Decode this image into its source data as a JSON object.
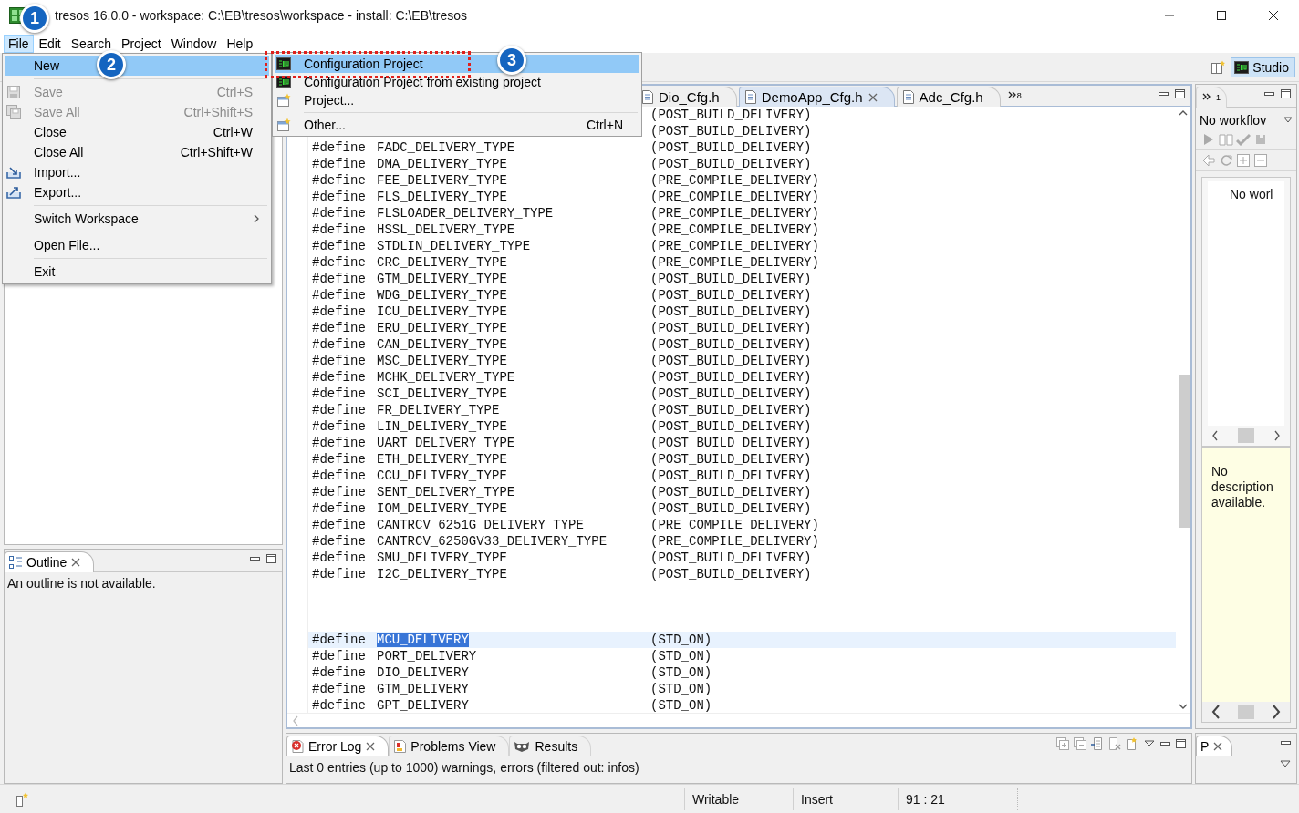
{
  "window": {
    "title": "tresos 16.0.0 - workspace: C:\\EB\\tresos\\workspace - install: C:\\EB\\tresos"
  },
  "menu_bar": [
    {
      "label": "File",
      "selected": true
    },
    {
      "label": "Edit",
      "selected": false
    },
    {
      "label": "Search",
      "selected": false
    },
    {
      "label": "Project",
      "selected": false
    },
    {
      "label": "Window",
      "selected": false
    },
    {
      "label": "Help",
      "selected": false
    }
  ],
  "file_menu": [
    {
      "kind": "item",
      "label": "New",
      "selected": true,
      "disabled": false,
      "submenu": false
    },
    {
      "kind": "separator"
    },
    {
      "kind": "item",
      "label": "Save",
      "shortcut": "Ctrl+S",
      "selected": false,
      "disabled": true,
      "submenu": false
    },
    {
      "kind": "item",
      "label": "Save All",
      "shortcut": "Ctrl+Shift+S",
      "selected": false,
      "disabled": true,
      "submenu": false
    },
    {
      "kind": "item",
      "label": "Close",
      "shortcut": "Ctrl+W",
      "selected": false,
      "disabled": false,
      "submenu": false
    },
    {
      "kind": "item",
      "label": "Close All",
      "shortcut": "Ctrl+Shift+W",
      "selected": false,
      "disabled": false,
      "submenu": false
    },
    {
      "kind": "item",
      "label": "Import...",
      "selected": false,
      "disabled": false,
      "submenu": false
    },
    {
      "kind": "item",
      "label": "Export...",
      "selected": false,
      "disabled": false,
      "submenu": false
    },
    {
      "kind": "separator"
    },
    {
      "kind": "item",
      "label": "Switch Workspace",
      "selected": false,
      "disabled": false,
      "submenu": true
    },
    {
      "kind": "separator"
    },
    {
      "kind": "item",
      "label": "Open File...",
      "selected": false,
      "disabled": false,
      "submenu": false
    },
    {
      "kind": "separator"
    },
    {
      "kind": "item",
      "label": "Exit",
      "selected": false,
      "disabled": false,
      "submenu": false
    }
  ],
  "new_submenu": [
    {
      "kind": "item",
      "label": "Configuration Project",
      "selected": true,
      "marked": true
    },
    {
      "kind": "item",
      "label": "Configuration Project from existing project",
      "selected": false,
      "marked": false
    },
    {
      "kind": "item",
      "label": "Project...",
      "selected": false,
      "marked": false
    },
    {
      "kind": "separator"
    },
    {
      "kind": "item",
      "label": "Other...",
      "shortcut": "Ctrl+N",
      "selected": false,
      "marked": false
    }
  ],
  "callouts": [
    "1",
    "2",
    "3"
  ],
  "perspective": {
    "label": "Studio",
    "selected": true
  },
  "editor": {
    "tabs": [
      {
        "label": "Dio_Cfg.h",
        "selected": false,
        "closable": false
      },
      {
        "label": "DemoApp_Cfg.h",
        "selected": true,
        "closable": true
      },
      {
        "label": "Adc_Cfg.h",
        "selected": false,
        "closable": false
      }
    ],
    "overflow_count": "8",
    "lines": [
      {
        "kind": "value_only",
        "value": "(POST_BUILD_DELIVERY)"
      },
      {
        "kind": "value_only",
        "value": "(POST_BUILD_DELIVERY)"
      },
      {
        "kind": "define",
        "directive": "#define",
        "name": "FADC_DELIVERY_TYPE",
        "value": "(POST_BUILD_DELIVERY)",
        "highlighted": false,
        "selected": false
      },
      {
        "kind": "define",
        "directive": "#define",
        "name": "DMA_DELIVERY_TYPE",
        "value": "(POST_BUILD_DELIVERY)",
        "highlighted": false,
        "selected": false
      },
      {
        "kind": "define",
        "directive": "#define",
        "name": "FEE_DELIVERY_TYPE",
        "value": "(PRE_COMPILE_DELIVERY)",
        "highlighted": false,
        "selected": false
      },
      {
        "kind": "define",
        "directive": "#define",
        "name": "FLS_DELIVERY_TYPE",
        "value": "(PRE_COMPILE_DELIVERY)",
        "highlighted": false,
        "selected": false
      },
      {
        "kind": "define",
        "directive": "#define",
        "name": "FLSLOADER_DELIVERY_TYPE",
        "value": "(PRE_COMPILE_DELIVERY)",
        "highlighted": false,
        "selected": false
      },
      {
        "kind": "define",
        "directive": "#define",
        "name": "HSSL_DELIVERY_TYPE",
        "value": "(PRE_COMPILE_DELIVERY)",
        "highlighted": false,
        "selected": false
      },
      {
        "kind": "define",
        "directive": "#define",
        "name": "STDLIN_DELIVERY_TYPE",
        "value": "(PRE_COMPILE_DELIVERY)",
        "highlighted": false,
        "selected": false
      },
      {
        "kind": "define",
        "directive": "#define",
        "name": "CRC_DELIVERY_TYPE",
        "value": "(PRE_COMPILE_DELIVERY)",
        "highlighted": false,
        "selected": false
      },
      {
        "kind": "define",
        "directive": "#define",
        "name": "GTM_DELIVERY_TYPE",
        "value": "(POST_BUILD_DELIVERY)",
        "highlighted": false,
        "selected": false
      },
      {
        "kind": "define",
        "directive": "#define",
        "name": "WDG_DELIVERY_TYPE",
        "value": "(POST_BUILD_DELIVERY)",
        "highlighted": false,
        "selected": false
      },
      {
        "kind": "define",
        "directive": "#define",
        "name": "ICU_DELIVERY_TYPE",
        "value": "(POST_BUILD_DELIVERY)",
        "highlighted": false,
        "selected": false
      },
      {
        "kind": "define",
        "directive": "#define",
        "name": "ERU_DELIVERY_TYPE",
        "value": "(POST_BUILD_DELIVERY)",
        "highlighted": false,
        "selected": false
      },
      {
        "kind": "define",
        "directive": "#define",
        "name": "CAN_DELIVERY_TYPE",
        "value": "(POST_BUILD_DELIVERY)",
        "highlighted": false,
        "selected": false
      },
      {
        "kind": "define",
        "directive": "#define",
        "name": "MSC_DELIVERY_TYPE",
        "value": "(POST_BUILD_DELIVERY)",
        "highlighted": false,
        "selected": false
      },
      {
        "kind": "define",
        "directive": "#define",
        "name": "MCHK_DELIVERY_TYPE",
        "value": "(POST_BUILD_DELIVERY)",
        "highlighted": false,
        "selected": false
      },
      {
        "kind": "define",
        "directive": "#define",
        "name": "SCI_DELIVERY_TYPE",
        "value": "(POST_BUILD_DELIVERY)",
        "highlighted": false,
        "selected": false
      },
      {
        "kind": "define",
        "directive": "#define",
        "name": "FR_DELIVERY_TYPE",
        "value": "(POST_BUILD_DELIVERY)",
        "highlighted": false,
        "selected": false
      },
      {
        "kind": "define",
        "directive": "#define",
        "name": "LIN_DELIVERY_TYPE",
        "value": "(POST_BUILD_DELIVERY)",
        "highlighted": false,
        "selected": false
      },
      {
        "kind": "define",
        "directive": "#define",
        "name": "UART_DELIVERY_TYPE",
        "value": "(POST_BUILD_DELIVERY)",
        "highlighted": false,
        "selected": false
      },
      {
        "kind": "define",
        "directive": "#define",
        "name": "ETH_DELIVERY_TYPE",
        "value": "(POST_BUILD_DELIVERY)",
        "highlighted": false,
        "selected": false
      },
      {
        "kind": "define",
        "directive": "#define",
        "name": "CCU_DELIVERY_TYPE",
        "value": "(POST_BUILD_DELIVERY)",
        "highlighted": false,
        "selected": false
      },
      {
        "kind": "define",
        "directive": "#define",
        "name": "SENT_DELIVERY_TYPE",
        "value": "(POST_BUILD_DELIVERY)",
        "highlighted": false,
        "selected": false
      },
      {
        "kind": "define",
        "directive": "#define",
        "name": "IOM_DELIVERY_TYPE",
        "value": "(POST_BUILD_DELIVERY)",
        "highlighted": false,
        "selected": false
      },
      {
        "kind": "define",
        "directive": "#define",
        "name": "CANTRCV_6251G_DELIVERY_TYPE",
        "value": "(PRE_COMPILE_DELIVERY)",
        "highlighted": false,
        "selected": false
      },
      {
        "kind": "define",
        "directive": "#define",
        "name": "CANTRCV_6250GV33_DELIVERY_TYPE",
        "value": "(PRE_COMPILE_DELIVERY)",
        "highlighted": false,
        "selected": false
      },
      {
        "kind": "define",
        "directive": "#define",
        "name": "SMU_DELIVERY_TYPE",
        "value": "(POST_BUILD_DELIVERY)",
        "highlighted": false,
        "selected": false
      },
      {
        "kind": "define",
        "directive": "#define",
        "name": "I2C_DELIVERY_TYPE",
        "value": "(POST_BUILD_DELIVERY)",
        "highlighted": false,
        "selected": false
      },
      {
        "kind": "blank"
      },
      {
        "kind": "blank"
      },
      {
        "kind": "blank"
      },
      {
        "kind": "define",
        "directive": "#define",
        "name": "MCU_DELIVERY",
        "value": "(STD_ON)",
        "highlighted": true,
        "selected": true
      },
      {
        "kind": "define",
        "directive": "#define",
        "name": "PORT_DELIVERY",
        "value": "(STD_ON)",
        "highlighted": false,
        "selected": false
      },
      {
        "kind": "define",
        "directive": "#define",
        "name": "DIO_DELIVERY",
        "value": "(STD_ON)",
        "highlighted": false,
        "selected": false
      },
      {
        "kind": "define",
        "directive": "#define",
        "name": "GTM_DELIVERY",
        "value": "(STD_ON)",
        "highlighted": false,
        "selected": false
      },
      {
        "kind": "define",
        "directive": "#define",
        "name": "GPT_DELIVERY",
        "value": "(STD_ON)",
        "highlighted": false,
        "selected": false
      }
    ]
  },
  "outline": {
    "tab": "Outline",
    "message": "An outline is not available."
  },
  "workflow": {
    "overflow_count": "1",
    "dropdown": "No workflov",
    "list_text": "No worl",
    "description": "No description available."
  },
  "bottom_panel": {
    "tabs": [
      {
        "label": "Error Log",
        "selected": true,
        "closable": true
      },
      {
        "label": "Problems View",
        "selected": false,
        "closable": false
      },
      {
        "label": "Results",
        "selected": false,
        "closable": false
      }
    ],
    "message": "Last 0 entries (up to 1000) warnings, errors (filtered out: infos)"
  },
  "side_panel": {
    "tab": "P"
  },
  "status_bar": [
    "Writable",
    "Insert",
    "91 : 21"
  ]
}
